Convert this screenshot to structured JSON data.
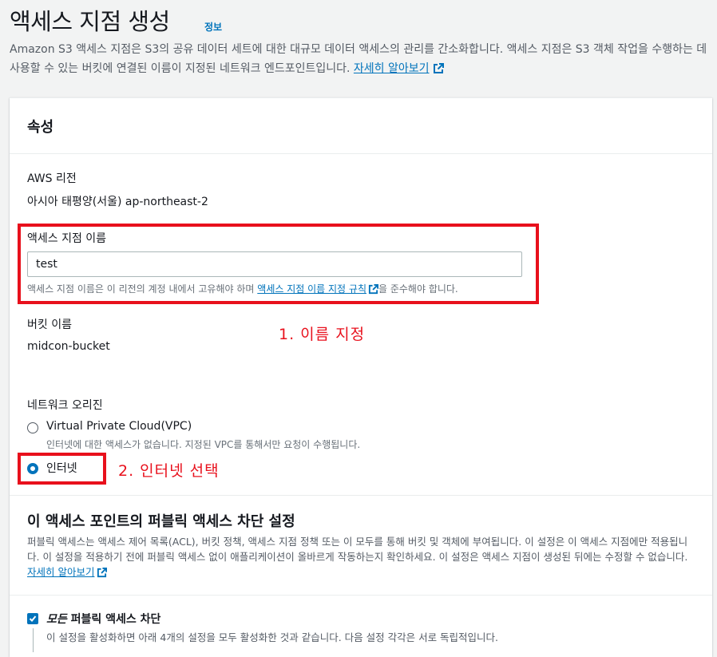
{
  "page": {
    "title": "액세스 지점 생성",
    "info": "정보",
    "description": "Amazon S3 액세스 지점은 S3의 공유 데이터 세트에 대한 대규모 데이터 액세스의 관리를 간소화합니다. 액세스 지점은 S3 객체 작업을 수행하는 데 사용할 수 있는 버킷에 연결된 이름이 지정된 네트워크 엔드포인트입니다.",
    "learn_more": "자세히 알아보기"
  },
  "properties": {
    "header": "속성",
    "region_label": "AWS 리전",
    "region_value": "아시아 태평양(서울) ap-northeast-2",
    "name_label": "액세스 지점 이름",
    "name_value": "test",
    "name_hint_pre": "액세스 지점 이름은 이 리전의 계정 내에서 고유해야 하며",
    "name_hint_link": "액세스 지점 이름 지정 규칙",
    "name_hint_post": "을 준수해야 합니다.",
    "bucket_label": "버킷 이름",
    "bucket_value": "midcon-bucket",
    "network_label": "네트워크 오리진",
    "vpc_option": "Virtual Private Cloud(VPC)",
    "vpc_hint": "인터넷에 대한 액세스가 없습니다. 지정된 VPC를 통해서만 요청이 수행됩니다.",
    "internet_option": "인터넷"
  },
  "block_public": {
    "title": "이 액세스 포인트의 퍼블릭 액세스 차단 설정",
    "description": "퍼블릭 액세스는 액세스 제어 목록(ACL), 버킷 정책, 액세스 지점 정책 또는 이 모두를 통해 버킷 및 객체에 부여됩니다. 이 설정은 이 액세스 지점에만 적용됩니다. 이 설정을 적용하기 전에 퍼블릭 액세스 없이 애플리케이션이 올바르게 작동하는지 확인하세요. 이 설정은 액세스 지점이 생성된 뒤에는 수정할 수 없습니다.",
    "learn_more": "자세히 알아보기",
    "block_all_em": "모든",
    "block_all_rest": " 퍼블릭 액세스 차단",
    "block_all_hint": "이 설정을 활성화하면 아래 4개의 설정을 모두 활성화한 것과 같습니다. 다음 설정 각각은 서로 독립적입니다."
  },
  "annotations": {
    "step1": "1. 이름 지정",
    "step2": "2. 인터넷 선택"
  },
  "colors": {
    "link": "#0073bb",
    "annotation": "#e8101c",
    "background": "#f2f3f3"
  }
}
